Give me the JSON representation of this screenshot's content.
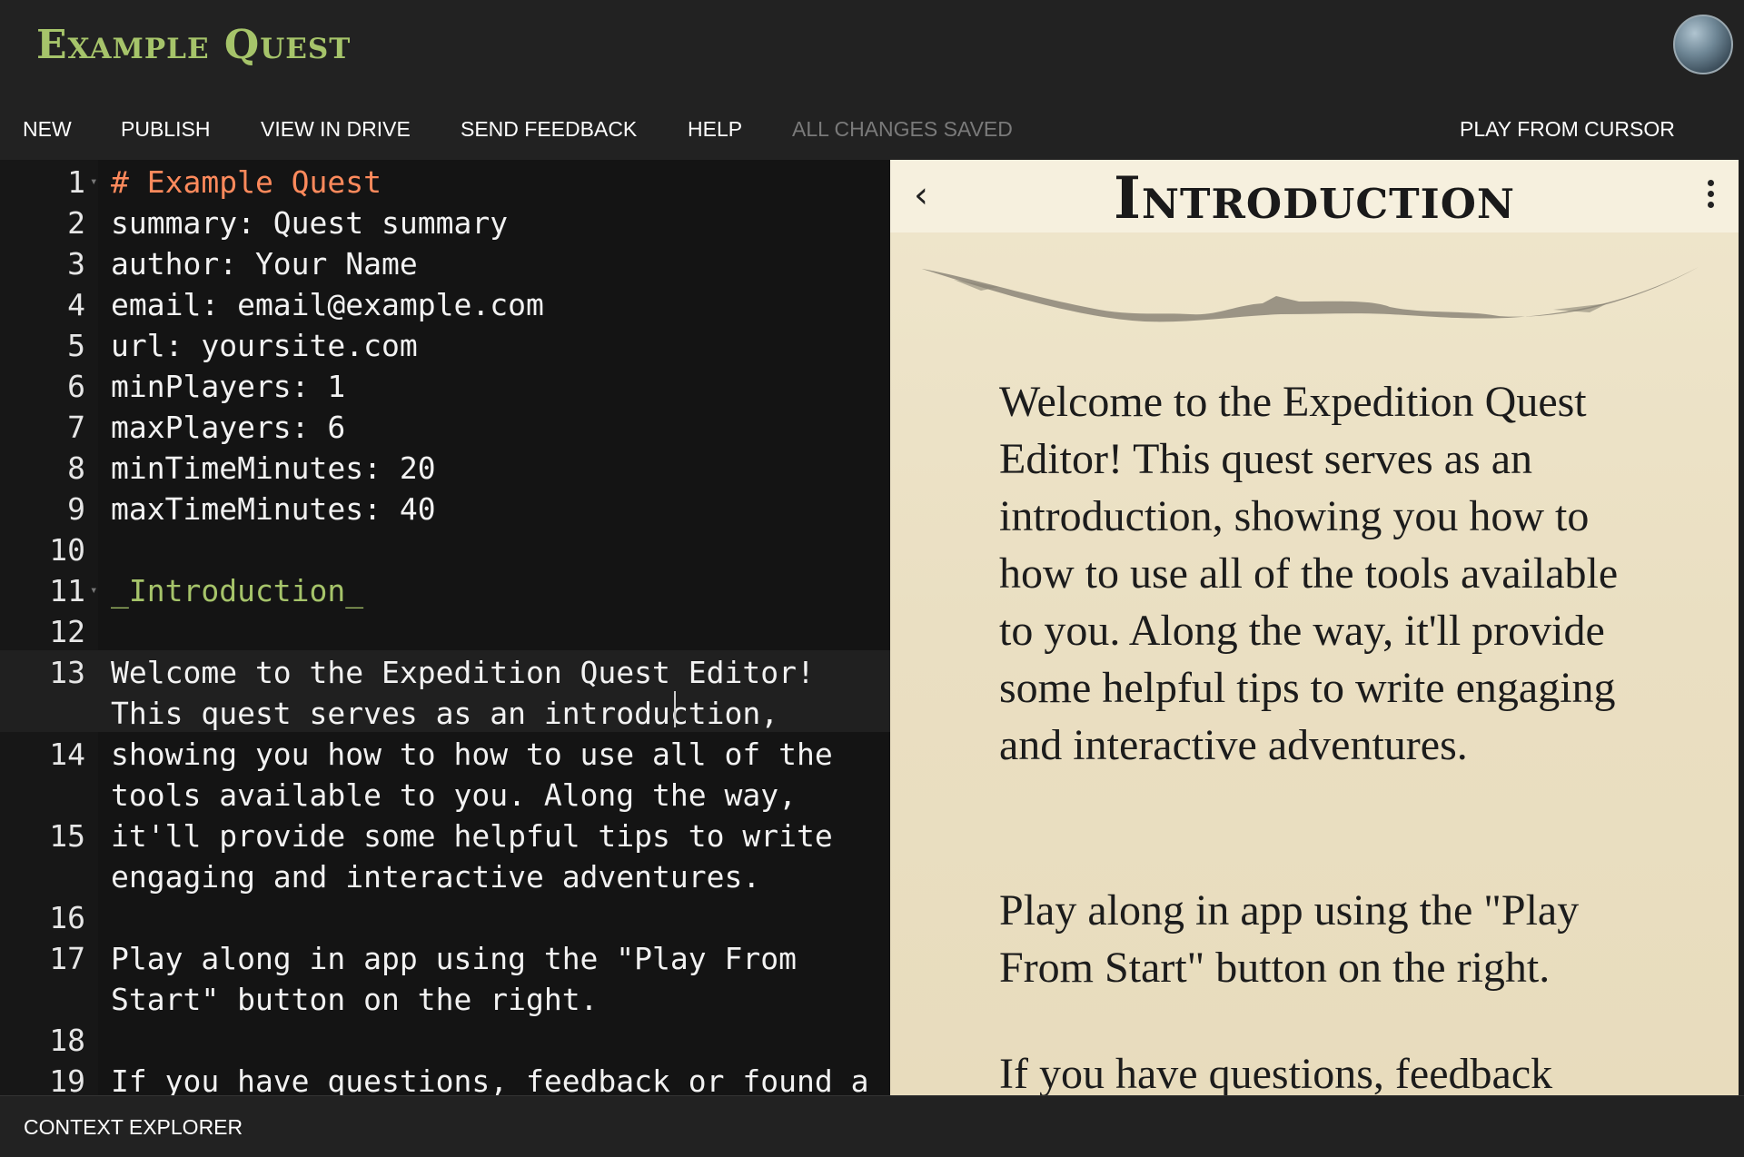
{
  "header": {
    "title": "Example Quest",
    "avatar": "user-avatar"
  },
  "menu": {
    "new": "NEW",
    "publish": "PUBLISH",
    "view_in_drive": "VIEW IN DRIVE",
    "send_feedback": "SEND FEEDBACK",
    "help": "HELP",
    "status": "ALL CHANGES SAVED",
    "play_from_cursor": "PLAY FROM CURSOR"
  },
  "editor": {
    "lines": [
      {
        "n": "1",
        "text": "# Example Quest"
      },
      {
        "n": "2",
        "text": "summary: Quest summary"
      },
      {
        "n": "3",
        "text": "author: Your Name"
      },
      {
        "n": "4",
        "text": "email: email@example.com"
      },
      {
        "n": "5",
        "text": "url: yoursite.com"
      },
      {
        "n": "6",
        "text": "minPlayers: 1"
      },
      {
        "n": "7",
        "text": "maxPlayers: 6"
      },
      {
        "n": "8",
        "text": "minTimeMinutes: 20"
      },
      {
        "n": "9",
        "text": "maxTimeMinutes: 40"
      },
      {
        "n": "10",
        "text": ""
      },
      {
        "n": "11",
        "text": "_Introduction_"
      },
      {
        "n": "12",
        "text": ""
      },
      {
        "n": "13",
        "text": "Welcome to the Expedition Quest Editor!"
      },
      {
        "n": "",
        "text": "This quest serves as an introduction,"
      },
      {
        "n": "14",
        "text": "showing you how to how to use all of the"
      },
      {
        "n": "",
        "text": "tools available to you. Along the way,"
      },
      {
        "n": "15",
        "text": "it'll provide some helpful tips to write"
      },
      {
        "n": "",
        "text": "engaging and interactive adventures."
      },
      {
        "n": "16",
        "text": ""
      },
      {
        "n": "17",
        "text": "Play along in app using the \"Play From"
      },
      {
        "n": "",
        "text": "Start\" button on the right."
      },
      {
        "n": "18",
        "text": ""
      },
      {
        "n": "19",
        "text": "If you have questions, feedback or found a"
      }
    ]
  },
  "preview": {
    "title": "Introduction",
    "paragraphs": [
      "Welcome to the Expedition Quest Editor! This quest serves as an introduction, showing you how to how to use all of the tools available to you. Along the way, it'll provide some helpful tips to write engaging and interactive adventures.",
      "Play along in app using the \"Play From Start\" button on the right.",
      "If you have questions, feedback"
    ],
    "back_icon": "chevron-left-icon",
    "menu_icon": "more-vertical-icon"
  },
  "footer": {
    "label": "CONTEXT EXPLORER"
  },
  "colors": {
    "title_accent": "#a6c46a",
    "heading_code": "#ff8a5c",
    "card_code": "#a6c46a",
    "status_disabled": "#7a7a7a"
  }
}
